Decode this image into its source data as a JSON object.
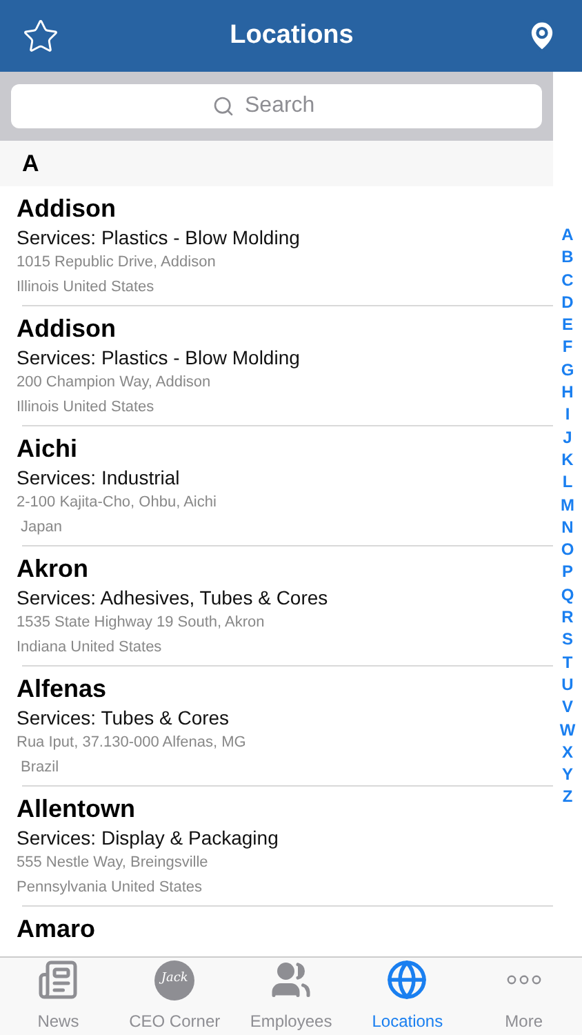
{
  "header": {
    "title": "Locations"
  },
  "search": {
    "placeholder": "Search"
  },
  "section": {
    "title": "A"
  },
  "locations": [
    {
      "name": "Addison",
      "services": "Services: Plastics - Blow Molding",
      "address": "1015 Republic Drive, Addison",
      "region": "Illinois United States"
    },
    {
      "name": "Addison",
      "services": "Services: Plastics - Blow Molding",
      "address": "200 Champion Way, Addison",
      "region": "Illinois United States"
    },
    {
      "name": "Aichi",
      "services": "Services: Industrial",
      "address": "2-100 Kajita-Cho, Ohbu, Aichi",
      "region": " Japan"
    },
    {
      "name": "Akron",
      "services": "Services: Adhesives, Tubes & Cores",
      "address": "1535 State Highway 19 South, Akron",
      "region": "Indiana United States"
    },
    {
      "name": "Alfenas",
      "services": "Services: Tubes & Cores",
      "address": "Rua Iput, 37.130-000 Alfenas, MG",
      "region": " Brazil"
    },
    {
      "name": "Allentown",
      "services": "Services: Display & Packaging",
      "address": "555 Nestle Way, Breingsville",
      "region": "Pennsylvania United States"
    },
    {
      "name": "Amaro"
    }
  ],
  "index": [
    "A",
    "B",
    "C",
    "D",
    "E",
    "F",
    "G",
    "H",
    "I",
    "J",
    "K",
    "L",
    "M",
    "N",
    "O",
    "P",
    "Q",
    "R",
    "S",
    "T",
    "U",
    "V",
    "W",
    "X",
    "Y",
    "Z"
  ],
  "tabs": [
    {
      "kind": "news",
      "label": "News",
      "selected": false
    },
    {
      "kind": "ceo",
      "label": "CEO Corner",
      "logo": "Jack",
      "selected": false
    },
    {
      "kind": "people",
      "label": "Employees",
      "selected": false
    },
    {
      "kind": "globe",
      "label": "Locations",
      "selected": true
    },
    {
      "kind": "more",
      "label": "More",
      "selected": false
    }
  ]
}
